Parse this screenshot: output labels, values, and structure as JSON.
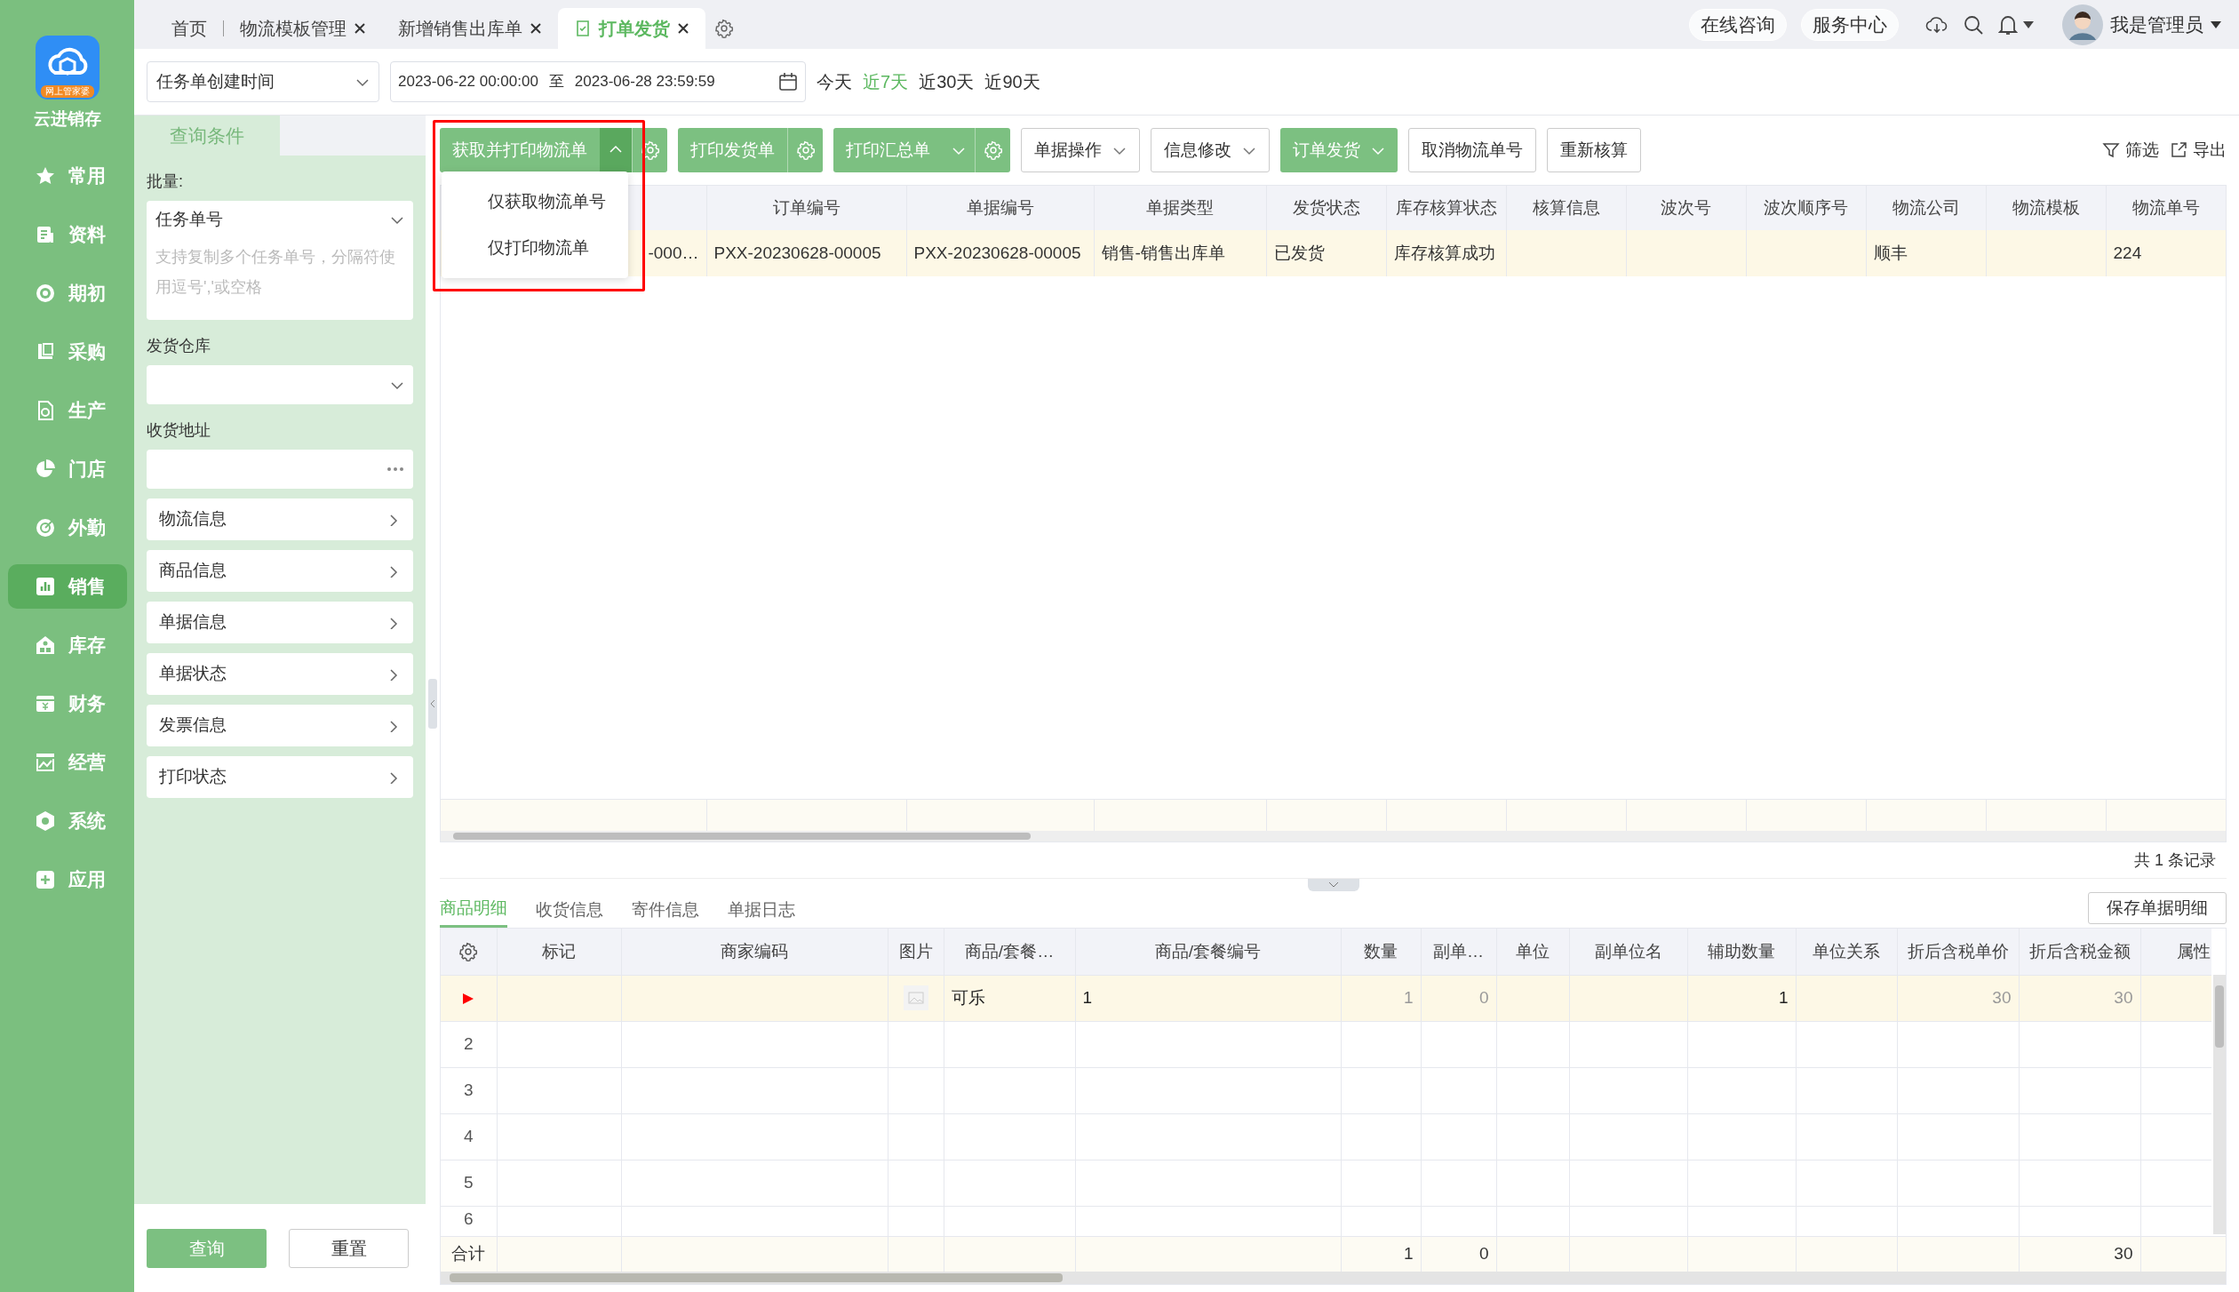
{
  "app": {
    "name": "云进销存",
    "badge": "网上管家婆"
  },
  "nav": [
    {
      "label": "常用",
      "selected": false
    },
    {
      "label": "资料",
      "selected": false
    },
    {
      "label": "期初",
      "selected": false
    },
    {
      "label": "采购",
      "selected": false
    },
    {
      "label": "生产",
      "selected": false
    },
    {
      "label": "门店",
      "selected": false
    },
    {
      "label": "外勤",
      "selected": false
    },
    {
      "label": "销售",
      "selected": true
    },
    {
      "label": "库存",
      "selected": false
    },
    {
      "label": "财务",
      "selected": false
    },
    {
      "label": "经营",
      "selected": false
    },
    {
      "label": "系统",
      "selected": false
    },
    {
      "label": "应用",
      "selected": false
    }
  ],
  "tabs": [
    {
      "label": "首页",
      "closable": false,
      "selected": false
    },
    {
      "label": "物流模板管理",
      "closable": true,
      "selected": false
    },
    {
      "label": "新增销售出库单",
      "closable": true,
      "selected": false
    },
    {
      "label": "打单发货",
      "closable": true,
      "selected": true
    }
  ],
  "header_links": [
    "在线咨询",
    "服务中心"
  ],
  "user": {
    "name": "我是管理员"
  },
  "filter": {
    "time_field": "任务单创建时间",
    "start": "2023-06-22 00:00:00",
    "separator": "至",
    "end": "2023-06-28 23:59:59",
    "quick": [
      {
        "label": "今天",
        "selected": false
      },
      {
        "label": "近7天",
        "selected": true
      },
      {
        "label": "近30天",
        "selected": false
      },
      {
        "label": "近90天",
        "selected": false
      }
    ]
  },
  "query_panel": {
    "title": "查询条件",
    "batch_label": "批量:",
    "batch_field": "任务单号",
    "batch_placeholder": "支持复制多个任务单号，分隔符使用逗号','或空格",
    "warehouse_label": "发货仓库",
    "address_label": "收货地址",
    "sections": [
      "物流信息",
      "商品信息",
      "单据信息",
      "单据状态",
      "发票信息",
      "打印状态"
    ],
    "buttons": [
      {
        "label": "查询",
        "kind": "primary"
      },
      {
        "label": "重置",
        "kind": "default"
      }
    ]
  },
  "toolbar": {
    "buttons": [
      {
        "label": "获取并打印物流单",
        "kind": "primary",
        "dropdown": true,
        "expanded": true,
        "gear": true
      },
      {
        "label": "打印发货单",
        "kind": "primary",
        "gear": true
      },
      {
        "label": "打印汇总单",
        "kind": "primary",
        "dropdown": true,
        "expanded": false,
        "gear": true
      },
      {
        "label": "单据操作",
        "kind": "default",
        "dropdown": true,
        "expanded": false,
        "gear": false
      },
      {
        "label": "信息修改",
        "kind": "default",
        "dropdown": true,
        "expanded": false,
        "gear": false
      },
      {
        "label": "订单发货",
        "kind": "primary",
        "dropdown": true,
        "expanded": false,
        "gear": false
      },
      {
        "label": "取消物流单号",
        "kind": "default",
        "gear": false
      },
      {
        "label": "重新核算",
        "kind": "default",
        "gear": false
      }
    ],
    "tools": [
      {
        "label": "筛选",
        "kind": "filter"
      },
      {
        "label": "导出",
        "kind": "export"
      }
    ]
  },
  "dropdown": {
    "items": [
      "仅获取物流单号",
      "仅打印物流单"
    ]
  },
  "orders_table": {
    "columns": [
      "订单编号",
      "单据编号",
      "单据类型",
      "发货状态",
      "库存核算状态",
      "核算信息",
      "波次号",
      "波次顺序号",
      "物流公司",
      "物流模板",
      "物流单号"
    ],
    "rows": [
      {
        "covered_cell": "-000…",
        "cells": [
          "PXX-20230628-00005",
          "PXX-20230628-00005",
          "销售-销售出库单",
          "已发货",
          "库存核算成功",
          null,
          null,
          null,
          "顺丰",
          null,
          "224"
        ]
      }
    ],
    "record_count": "共 1 条记录"
  },
  "detail": {
    "tabs": [
      {
        "label": "商品明细",
        "selected": true
      },
      {
        "label": "收货信息",
        "selected": false
      },
      {
        "label": "寄件信息",
        "selected": false
      },
      {
        "label": "单据日志",
        "selected": false
      }
    ],
    "save_button": "保存单据明细",
    "columns": [
      {
        "label": "标记",
        "kind": "text"
      },
      {
        "label": "商家编码",
        "kind": "text"
      },
      {
        "label": "图片",
        "kind": "image"
      },
      {
        "label": "商品/套餐…",
        "kind": "text"
      },
      {
        "label": "商品/套餐编号",
        "kind": "text"
      },
      {
        "label": "数量",
        "kind": "number",
        "readonly": true,
        "total": "1"
      },
      {
        "label": "副单…",
        "kind": "number",
        "readonly": true,
        "total": "0"
      },
      {
        "label": "单位",
        "kind": "text"
      },
      {
        "label": "副单位名",
        "kind": "text"
      },
      {
        "label": "辅助数量",
        "kind": "number",
        "readonly": false
      },
      {
        "label": "单位关系",
        "kind": "text"
      },
      {
        "label": "折后含税单价",
        "kind": "number",
        "readonly": true
      },
      {
        "label": "折后含税金额",
        "kind": "number",
        "readonly": true,
        "total": "30"
      },
      {
        "label": "属性",
        "kind": "text"
      }
    ],
    "rows": [
      {
        "selected": true,
        "has_image": true,
        "cells": [
          null,
          null,
          null,
          "可乐",
          "1",
          "1",
          "0",
          null,
          null,
          "1",
          null,
          "30",
          "30",
          null
        ]
      },
      {
        "selected": false,
        "index": "2"
      },
      {
        "selected": false,
        "index": "3"
      },
      {
        "selected": false,
        "index": "4"
      },
      {
        "selected": false,
        "index": "5"
      },
      {
        "selected": false,
        "index": "6"
      }
    ],
    "totals_label": "合计"
  }
}
